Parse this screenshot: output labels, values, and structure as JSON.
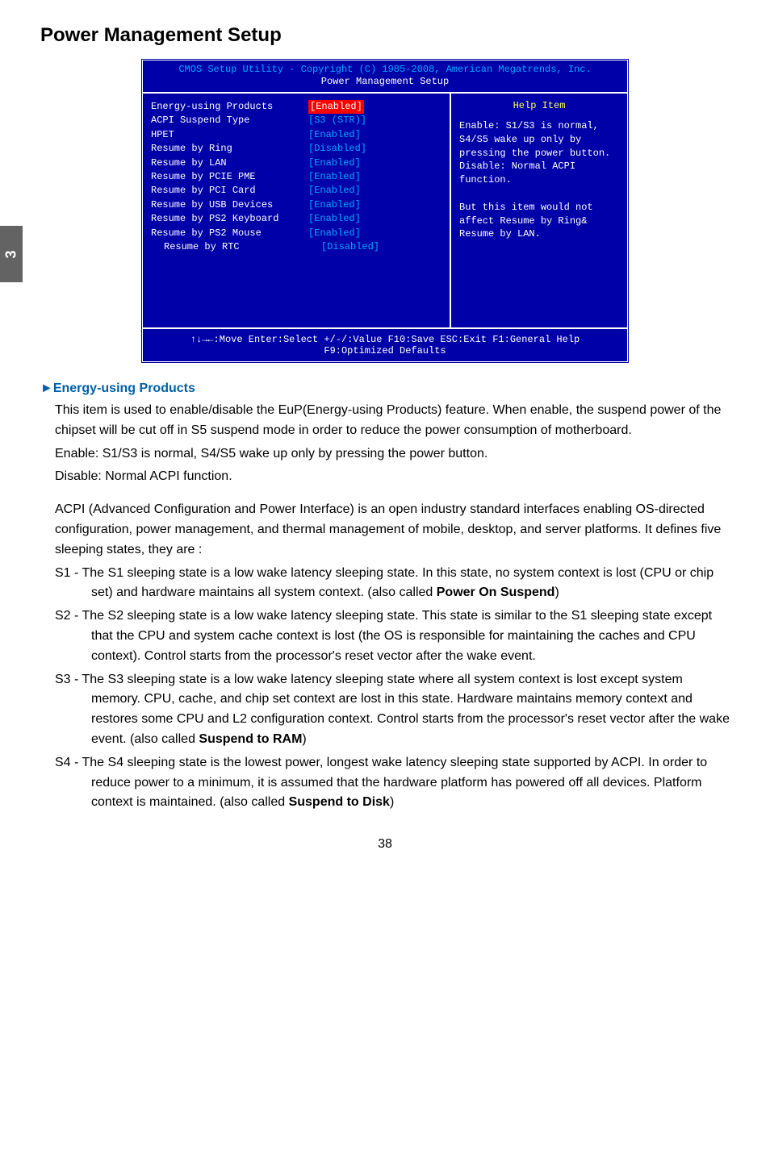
{
  "side_tab": "3",
  "heading": "Power Management Setup",
  "bios": {
    "title": "CMOS Setup Utility - Copyright (C) 1985-2008, American Megatrends, Inc.",
    "subtitle": "Power Management Setup",
    "rows": [
      {
        "label": "Energy-using Products",
        "value": "[Enabled]",
        "highlight": true,
        "indent": false
      },
      {
        "label": "ACPI Suspend Type",
        "value": "[S3 (STR)]",
        "highlight": false,
        "indent": false
      },
      {
        "label": "HPET",
        "value": "[Enabled]",
        "highlight": false,
        "indent": false
      },
      {
        "label": "Resume by Ring",
        "value": "[Disabled]",
        "highlight": false,
        "indent": false
      },
      {
        "label": "Resume by LAN",
        "value": "[Enabled]",
        "highlight": false,
        "indent": false
      },
      {
        "label": "Resume by PCIE PME",
        "value": "[Enabled]",
        "highlight": false,
        "indent": false
      },
      {
        "label": "Resume by PCI Card",
        "value": "[Enabled]",
        "highlight": false,
        "indent": false
      },
      {
        "label": "Resume by USB Devices",
        "value": "[Enabled]",
        "highlight": false,
        "indent": false
      },
      {
        "label": "Resume by PS2 Keyboard",
        "value": "[Enabled]",
        "highlight": false,
        "indent": false
      },
      {
        "label": "Resume by PS2 Mouse",
        "value": "[Enabled]",
        "highlight": false,
        "indent": false
      },
      {
        "label": "Resume by RTC",
        "value": "[Disabled]",
        "highlight": false,
        "indent": true
      }
    ],
    "help_title": "Help Item",
    "help_body": "Enable: S1/S3 is normal, S4/S5 wake up only by pressing the power button.\nDisable: Normal ACPI function.\n\nBut this item would not affect Resume by Ring& Resume by LAN.",
    "footer": "↑↓→←:Move   Enter:Select   +/-/:Value   F10:Save    ESC:Exit   F1:General Help\nF9:Optimized Defaults"
  },
  "section": {
    "title": "►Energy-using Products",
    "p1": "This item is used to enable/disable the EuP(Energy-using Products) feature. When enable, the suspend power of the chipset will be cut off in S5 suspend mode in order to reduce the power consumption of motherboard.",
    "p2": "Enable: S1/S3 is normal, S4/S5 wake up only by pressing the power button.",
    "p3": "Disable: Normal ACPI function.",
    "p4": "ACPI (Advanced Configuration and Power Interface) is an open industry standard interfaces enabling OS-directed configuration, power management, and thermal management of mobile, desktop, and server platforms. It defines five sleeping states, they are :",
    "s1a": "S1 - The S1 sleeping state is a low wake latency sleeping state. In this state, no system context is lost (CPU or chip set) and hardware maintains all system context. (also called ",
    "s1b": "Power On Suspend",
    "s1c": ")",
    "s2": "S2 - The S2 sleeping state is a low wake latency sleeping state. This state is similar to the S1 sleeping state except that the CPU and system cache context is lost (the OS is responsible for maintaining the caches and CPU context). Control starts from the processor's reset vector after the wake event.",
    "s3a": "S3 - The S3 sleeping state is a low wake latency sleeping state where all system context is lost except system memory. CPU, cache, and chip set context are lost in this state. Hardware maintains memory context and restores some CPU and L2 configuration context. Control starts from the processor's reset vector after the wake event. (also called ",
    "s3b": "Suspend to RAM",
    "s3c": ")",
    "s4a": "S4 - The S4 sleeping state is the lowest power, longest wake latency sleeping state supported by ACPI. In order to reduce power to a minimum, it is assumed that the hardware platform has powered off all devices. Platform context is maintained. (also called ",
    "s4b": "Suspend to Disk",
    "s4c": ")"
  },
  "page_number": "38"
}
